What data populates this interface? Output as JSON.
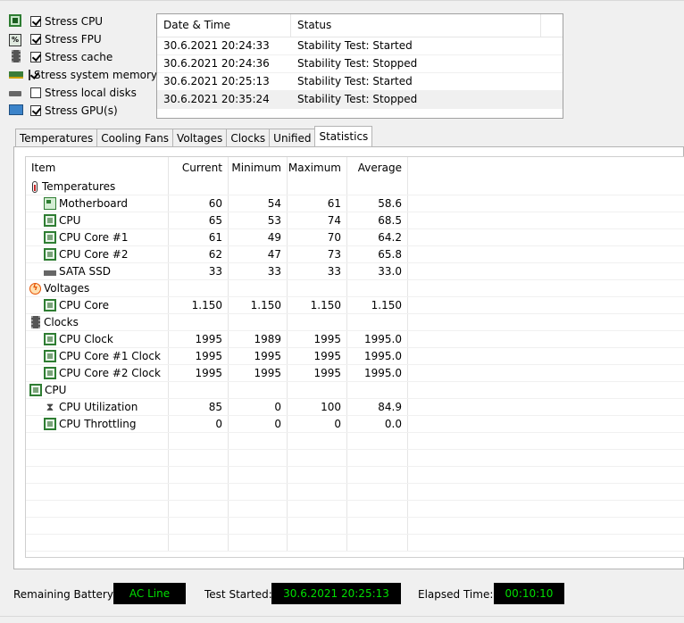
{
  "stress_options": [
    {
      "label": "Stress CPU",
      "checked": true,
      "icon": "cpu-chip-icon"
    },
    {
      "label": "Stress FPU",
      "checked": true,
      "icon": "fpu-icon"
    },
    {
      "label": "Stress cache",
      "checked": true,
      "icon": "cache-icon"
    },
    {
      "label": "Stress system memory",
      "checked": true,
      "icon": "memory-icon"
    },
    {
      "label": "Stress local disks",
      "checked": false,
      "icon": "disk-icon"
    },
    {
      "label": "Stress GPU(s)",
      "checked": true,
      "icon": "gpu-icon"
    }
  ],
  "log": {
    "headers": [
      "Date & Time",
      "Status"
    ],
    "rows": [
      {
        "datetime": "30.6.2021 20:24:33",
        "status": "Stability Test: Started"
      },
      {
        "datetime": "30.6.2021 20:24:36",
        "status": "Stability Test: Stopped"
      },
      {
        "datetime": "30.6.2021 20:25:13",
        "status": "Stability Test: Started"
      },
      {
        "datetime": "30.6.2021 20:35:24",
        "status": "Stability Test: Stopped"
      }
    ]
  },
  "tabs": [
    {
      "label": "Temperatures",
      "active": false
    },
    {
      "label": "Cooling Fans",
      "active": false
    },
    {
      "label": "Voltages",
      "active": false
    },
    {
      "label": "Clocks",
      "active": false
    },
    {
      "label": "Unified",
      "active": false
    },
    {
      "label": "Statistics",
      "active": true
    }
  ],
  "stats": {
    "headers": [
      "Item",
      "Current",
      "Minimum",
      "Maximum",
      "Average"
    ],
    "rows": [
      {
        "type": "group",
        "icon": "thermometer-icon",
        "label": "Temperatures"
      },
      {
        "type": "item",
        "icon": "motherboard-icon",
        "label": "Motherboard",
        "current": "60",
        "min": "54",
        "max": "61",
        "avg": "58.6"
      },
      {
        "type": "item",
        "icon": "cpu-icon",
        "label": "CPU",
        "current": "65",
        "min": "53",
        "max": "74",
        "avg": "68.5"
      },
      {
        "type": "item",
        "icon": "cpu-icon",
        "label": "CPU Core #1",
        "current": "61",
        "min": "49",
        "max": "70",
        "avg": "64.2"
      },
      {
        "type": "item",
        "icon": "cpu-icon",
        "label": "CPU Core #2",
        "current": "62",
        "min": "47",
        "max": "73",
        "avg": "65.8"
      },
      {
        "type": "item",
        "icon": "ssd-icon",
        "label": "SATA SSD",
        "current": "33",
        "min": "33",
        "max": "33",
        "avg": "33.0"
      },
      {
        "type": "group",
        "icon": "voltage-icon",
        "label": "Voltages"
      },
      {
        "type": "item",
        "icon": "cpu-icon",
        "label": "CPU Core",
        "current": "1.150",
        "min": "1.150",
        "max": "1.150",
        "avg": "1.150"
      },
      {
        "type": "group",
        "icon": "clock-icon",
        "label": "Clocks"
      },
      {
        "type": "item",
        "icon": "cpu-icon",
        "label": "CPU Clock",
        "current": "1995",
        "min": "1989",
        "max": "1995",
        "avg": "1995.0"
      },
      {
        "type": "item",
        "icon": "cpu-icon",
        "label": "CPU Core #1 Clock",
        "current": "1995",
        "min": "1995",
        "max": "1995",
        "avg": "1995.0"
      },
      {
        "type": "item",
        "icon": "cpu-icon",
        "label": "CPU Core #2 Clock",
        "current": "1995",
        "min": "1995",
        "max": "1995",
        "avg": "1995.0"
      },
      {
        "type": "group",
        "icon": "cpu-icon",
        "label": "CPU"
      },
      {
        "type": "item",
        "icon": "hourglass-icon",
        "label": "CPU Utilization",
        "current": "85",
        "min": "0",
        "max": "100",
        "avg": "84.9"
      },
      {
        "type": "item",
        "icon": "cpu-icon",
        "label": "CPU Throttling",
        "current": "0",
        "min": "0",
        "max": "0",
        "avg": "0.0"
      }
    ]
  },
  "status_bar": {
    "battery_label": "Remaining Battery:",
    "battery_value": "AC Line",
    "test_started_label": "Test Started:",
    "test_started_value": "30.6.2021 20:25:13",
    "elapsed_label": "Elapsed Time:",
    "elapsed_value": "00:10:10"
  },
  "colors": {
    "led_text": "#00e000",
    "led_bg": "#000000"
  }
}
